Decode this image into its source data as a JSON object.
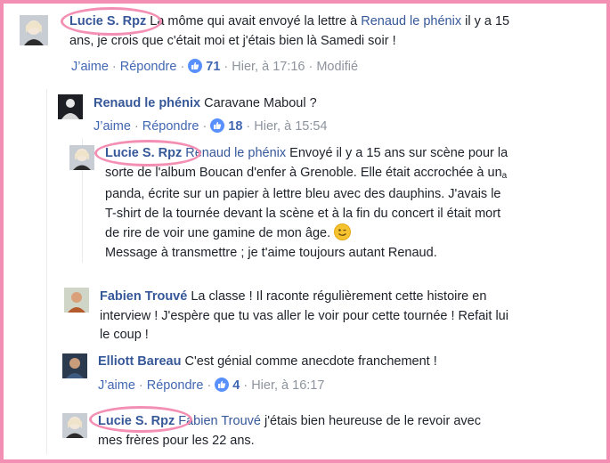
{
  "comments": [
    {
      "author": "Lucie S. Rpz",
      "lines": [
        "La môme qui avait envoyé la lettre à ",
        "ans, je crois que c'était moi et j'étais bien là Samedi soir !"
      ],
      "mention": "Renaud le phénix",
      "mention_tail": " il y a 15",
      "actions": {
        "like": "J’aime",
        "reply": "Répondre",
        "likes": "71",
        "time": "Hier, à 17:16",
        "edited": "Modifié"
      }
    },
    {
      "author": "Renaud le phénix",
      "body": "Caravane Maboul ?",
      "actions": {
        "like": "J’aime",
        "reply": "Répondre",
        "likes": "18",
        "time": "Hier, à 15:54"
      }
    },
    {
      "author": "Lucie S. Rpz",
      "mention": "Renaud le phénix",
      "first_line_tail": " Envoyé il y a 15 ans sur scène pour la",
      "lines": [
        "sorte de l'album Boucan d'enfer à Grenoble. Elle était accrochée à un",
        "panda, écrite sur un papier à lettre bleu avec des dauphins. J'avais le",
        "T-shirt de la tournée devant la scène et à la fin du concert il était mort",
        "de rire de voir une gamine de mon âge.",
        "Message à transmettre ; je t'aime toujours autant Renaud."
      ],
      "stray_char": "a"
    },
    {
      "author": "Fabien Trouvé",
      "first_line_tail": " La classe ! Il raconte régulièrement cette histoire en",
      "lines": [
        "interview ! J'espère que tu vas aller le voir pour cette tournée ! Refait lui",
        "le coup !"
      ]
    },
    {
      "author": "Elliott Bareau",
      "body": "C'est génial comme anecdote franchement !",
      "actions": {
        "like": "J’aime",
        "reply": "Répondre",
        "likes": "4",
        "time": "Hier, à 16:17"
      }
    },
    {
      "author": "Lucie S. Rpz",
      "mention": "Fabien Trouvé",
      "first_line_tail": " j'étais bien heureuse de le revoir avec",
      "lines": [
        "mes frères pour les 22 ans."
      ]
    }
  ],
  "separator": "·",
  "icons": {
    "like": "thumbs-up-icon",
    "emoji": "wink-emoji-icon"
  },
  "colors": {
    "highlight": "#f48fb4",
    "link": "#365899",
    "action": "#4267b2",
    "meta": "#8d949e",
    "like_badge": "#5890ff"
  }
}
